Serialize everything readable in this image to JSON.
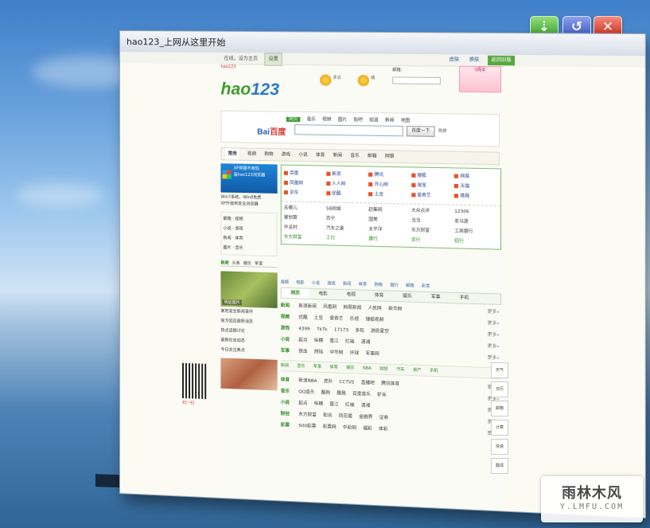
{
  "window": {
    "title": "hao123_上网从这里开始",
    "controls": {
      "green_icon": "down-arrow-icon",
      "blue_icon": "refresh-icon",
      "red_icon": "close-icon"
    }
  },
  "topbar": {
    "notice": "在线，设为主页",
    "button": "设置",
    "links": [
      "皮肤",
      "换肤",
      "消息"
    ],
    "green_button": "返回旧版"
  },
  "header": {
    "promo": "hao123",
    "logo_main": "hao",
    "logo_num": "123",
    "weather": [
      "多云",
      "晴"
    ],
    "mail_label": "邮箱：",
    "ad": "3周年"
  },
  "search": {
    "tabs": [
      "网页",
      "音乐",
      "视频",
      "图片",
      "贴吧",
      "知道",
      "新闻",
      "地图"
    ],
    "active_tab": "网页",
    "engine_a": "Bai",
    "engine_b": "百度",
    "button": "百度一下",
    "hot": "热搜"
  },
  "nav": [
    "常用",
    "视频",
    "购物",
    "游戏",
    "小说",
    "体育",
    "新闻",
    "音乐",
    "邮箱",
    "网银"
  ],
  "left": {
    "promo_line1": "XP停服不用怕",
    "promo_line2": "装hao123浏览器",
    "text1": "Win7系统，Win8免费",
    "text2": "XP升级到安全浏览器",
    "list": [
      "邮箱",
      "视频",
      "小说",
      "游戏",
      "新闻",
      "体育",
      "图片",
      "音乐"
    ],
    "tabs": [
      "新闻",
      "头条",
      "娱乐",
      "军事"
    ],
    "image_caption": "明星图片",
    "news": [
      "某地发生新闻事件",
      "官方回应最新消息",
      "热点话题讨论",
      "最新社会动态",
      "今日关注焦点"
    ],
    "qr_label": "扫一扫"
  },
  "famous_sites": [
    "百度",
    "新浪",
    "腾讯",
    "搜狐",
    "网易",
    "凤凰网",
    "人人网",
    "开心网",
    "淘宝",
    "天猫",
    "京东",
    "优酷",
    "土豆",
    "爱奇艺",
    "携程"
  ],
  "link_sites": [
    "去哪儿",
    "58同城",
    "赶集网",
    "大众点评",
    "12306",
    "聚划算",
    "苏宁",
    "国美",
    "当当",
    "亚马逊",
    "中关村",
    "汽车之家",
    "太平洋",
    "东方财富",
    "工商银行",
    "东方财富",
    "工行",
    "建行",
    "农行",
    "招行"
  ],
  "catbar": [
    "视频",
    "电影",
    "小说",
    "游戏",
    "新闻",
    "体育",
    "购物",
    "银行",
    "邮箱",
    "彩票"
  ],
  "content_tabs": [
    "网页",
    "电影",
    "电视",
    "体育",
    "娱乐",
    "军事",
    "手机",
    "购物"
  ],
  "categories": [
    {
      "k": "新闻",
      "v": [
        "新浪新闻",
        "凤凰网",
        "网易新闻",
        "人民网",
        "新华网"
      ]
    },
    {
      "k": "视频",
      "v": [
        "优酷",
        "土豆",
        "爱奇艺",
        "乐视",
        "搜狐视频"
      ]
    },
    {
      "k": "游戏",
      "v": [
        "4399",
        "7k7k",
        "17173",
        "多玩",
        "游民星空"
      ]
    },
    {
      "k": "小说",
      "v": [
        "起点",
        "纵横",
        "晋江",
        "红袖",
        "潇湘"
      ]
    },
    {
      "k": "军事",
      "v": [
        "铁血",
        "西陆",
        "中华网",
        "环球",
        "军事网"
      ]
    }
  ],
  "subtabs": [
    "新闻",
    "音乐",
    "军事",
    "体育",
    "娱乐",
    "NBA",
    "财经",
    "汽车",
    "房产",
    "手机"
  ],
  "categories2": [
    {
      "k": "体育",
      "v": [
        "新浪NBA",
        "虎扑",
        "CCTV5",
        "直播吧",
        "腾讯体育"
      ]
    },
    {
      "k": "音乐",
      "v": [
        "QQ音乐",
        "酷狗",
        "酷我",
        "百度音乐",
        "虾米"
      ]
    },
    {
      "k": "小说",
      "v": [
        "起点",
        "纵横",
        "晋江",
        "红袖",
        "潇湘"
      ]
    },
    {
      "k": "财经",
      "v": [
        "东方财富",
        "和讯",
        "同花顺",
        "金融界",
        "证券"
      ]
    },
    {
      "k": "彩票",
      "v": [
        "500彩票",
        "彩票网",
        "中彩网",
        "福彩",
        "体彩"
      ]
    }
  ],
  "more": "更多»",
  "side_tools": [
    "天气",
    "日历",
    "邮箱",
    "计算",
    "快递",
    "翻译"
  ],
  "watermark": {
    "big": "雨林木风",
    "small": "Y.LMFU.COM"
  }
}
